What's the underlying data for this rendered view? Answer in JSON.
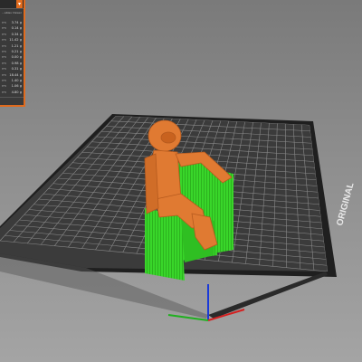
{
  "sidebar": {
    "title": "...ables Viewer",
    "dropdown_icon": "chevron-down-icon",
    "rows": [
      {
        "key": "rm",
        "value": "3.74 g"
      },
      {
        "key": "rm",
        "value": "0.14 g"
      },
      {
        "key": "rm",
        "value": "0.34 g"
      },
      {
        "key": "rm",
        "value": "11.42 g"
      },
      {
        "key": "rm",
        "value": "1.21 g"
      },
      {
        "key": "rm",
        "value": "0.21 g"
      },
      {
        "key": "rm",
        "value": "0.00 g"
      },
      {
        "key": "rm",
        "value": "0.98 g"
      },
      {
        "key": "rm",
        "value": "0.31 g"
      },
      {
        "key": "rm",
        "value": "18.44 g"
      },
      {
        "key": "rm",
        "value": "1.40 g"
      },
      {
        "key": "rm",
        "value": "1.06 g"
      },
      {
        "key": "rm",
        "value": "4.80 g"
      }
    ]
  },
  "bed": {
    "label": "ORIGINAL",
    "colors": {
      "plate": "#3b3b3b",
      "grid": "#8a8a8a",
      "frame": "#1f1f1f"
    }
  },
  "model": {
    "colors": {
      "perimeter": "#e07a32",
      "support": "#39d62a"
    }
  },
  "axes": {
    "colors": {
      "x": "#d42020",
      "y": "#20b020",
      "z": "#1a3ad8"
    }
  }
}
